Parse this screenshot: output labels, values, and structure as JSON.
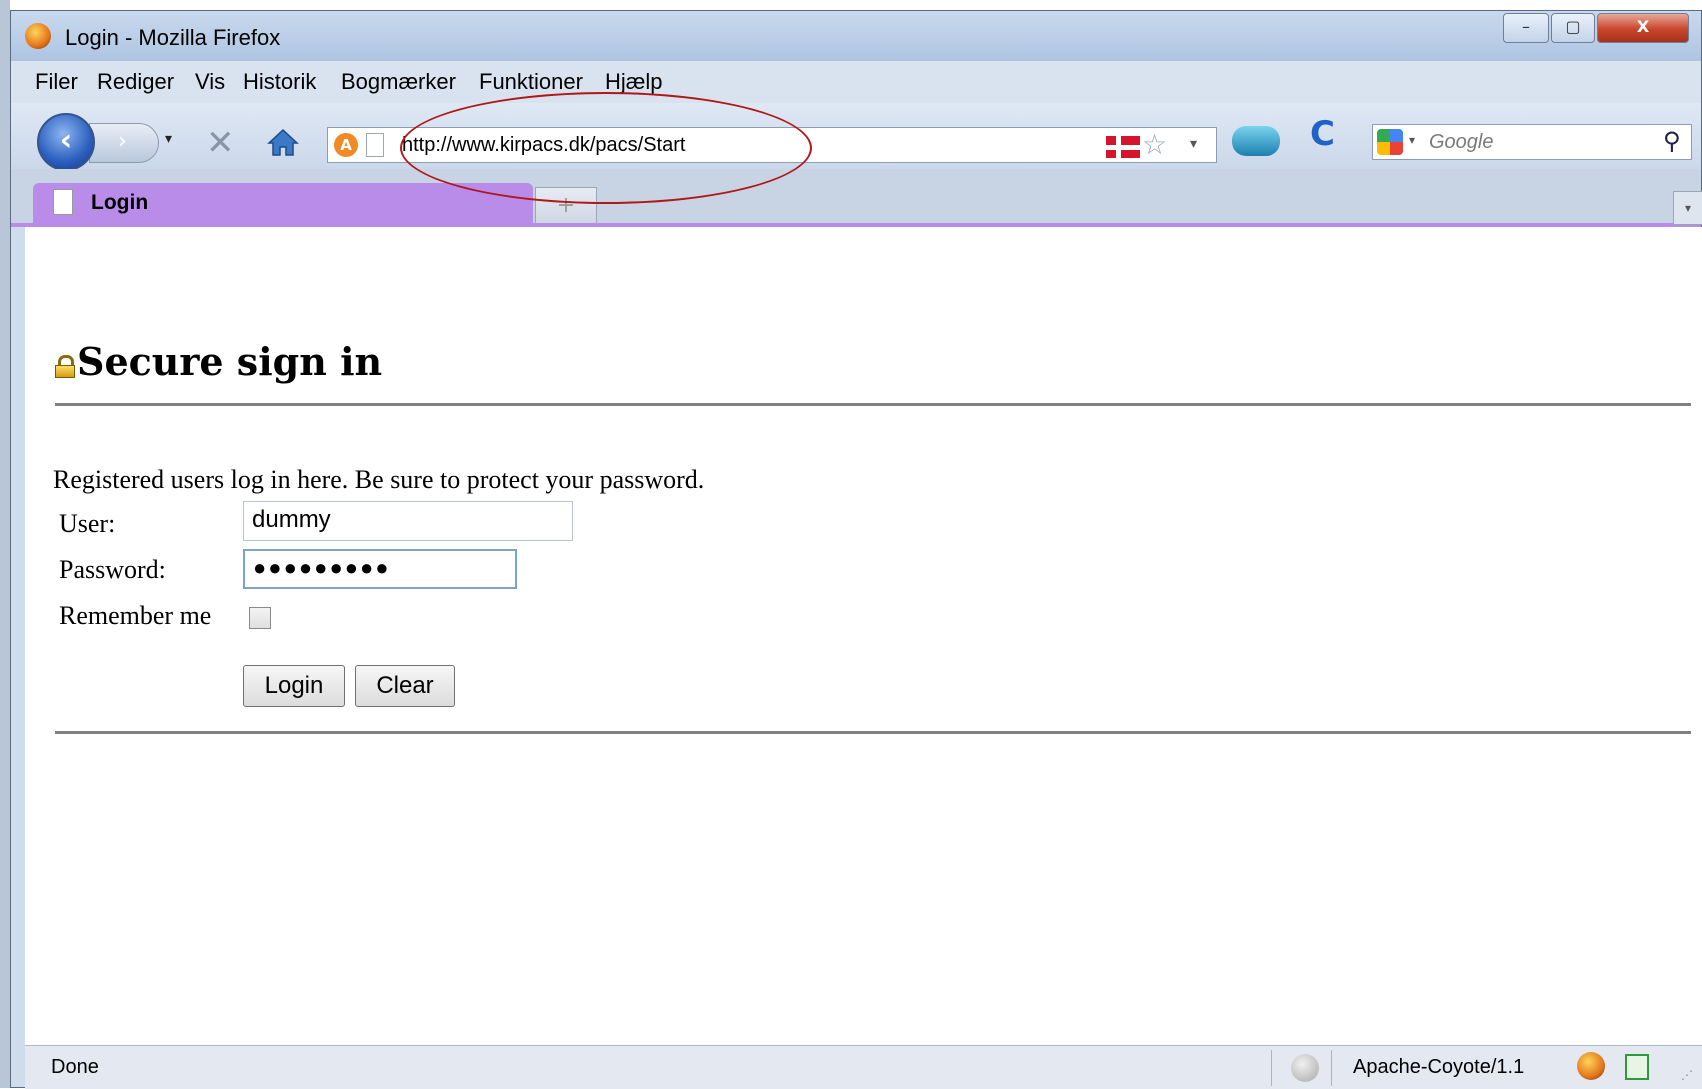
{
  "window": {
    "title": "Login - Mozilla Firefox",
    "min_glyph": "–",
    "max_glyph": "▢",
    "close_glyph": "X"
  },
  "menu": [
    "Filer",
    "Rediger",
    "Vis",
    "Historik",
    "Bogmærker",
    "Funktioner",
    "Hjælp"
  ],
  "nav": {
    "back_glyph": "‹",
    "forward_glyph": "›",
    "dropdown_glyph": "▾",
    "stop_glyph": "✕",
    "home_glyph": "⌂",
    "reload_glyph": "C",
    "site_icon_letter": "A",
    "url": "http://www.kirpacs.dk/pacs/Start",
    "star_glyph": "☆",
    "url_dropdown_glyph": "▾"
  },
  "search": {
    "placeholder": "Google",
    "dropdown_glyph": "▾",
    "search_glyph": "⚲"
  },
  "tabs": {
    "active_label": "Login",
    "new_tab_glyph": "+",
    "list_glyph": "▾"
  },
  "page": {
    "heading": "Secure sign in",
    "intro": "Registered users log in here. Be sure to protect your password.",
    "user_label": "User:",
    "user_value": "dummy",
    "password_label": "Password:",
    "password_value": "●●●●●●●●●",
    "remember_label": "Remember me",
    "remember_checked": false,
    "login_button": "Login",
    "clear_button": "Clear"
  },
  "status": {
    "text": "Done",
    "server": "Apache-Coyote/1.1",
    "grip_glyph": "⋰"
  },
  "colors": {
    "tab_active": "#b98ce9",
    "annotation": "#b01818",
    "url_bar_border": "#8c9cb4"
  },
  "icons": [
    "firefox-icon",
    "back-icon",
    "forward-icon",
    "stop-icon",
    "home-icon",
    "site-icon",
    "page-icon",
    "danish-flag-icon",
    "bookmark-star-icon",
    "cloud-icon",
    "reload-icon",
    "google-icon",
    "search-icon",
    "lock-icon",
    "status-dot-icon",
    "addon-icon"
  ]
}
